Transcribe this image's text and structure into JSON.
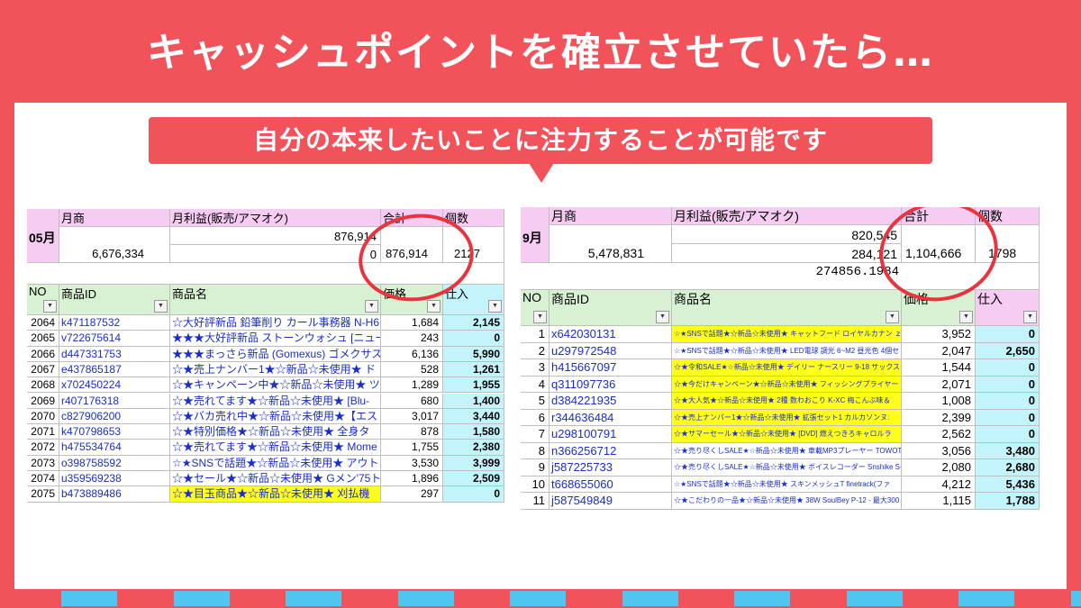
{
  "headline": "キャッシュポイントを確立させていたら…",
  "banner": "自分の本来したいことに注力することが可能です",
  "colors": {
    "bg": "#f2535a",
    "accent_stripe": "#4ec6ef",
    "circle": "#e8343e"
  },
  "left": {
    "month": "05月",
    "sales_label": "月商",
    "profit_label": "月利益(販売/アマオク)",
    "total_label": "合計",
    "count_label": "個数",
    "sales_value": "6,676,334",
    "profit_value_1": "876,914",
    "profit_value_2": "0",
    "total_value": "876,914",
    "count_value": "2127",
    "col_no": "NO",
    "col_id": "商品ID",
    "col_name": "商品名",
    "col_price": "価格",
    "col_buy": "仕入",
    "rows": [
      {
        "no": "2064",
        "id": "k471187532",
        "name": "☆大好評新品 鉛筆削り カール事務器 N-H6",
        "price": "1,684",
        "buy": "2,145"
      },
      {
        "no": "2065",
        "id": "v722675614",
        "name": "★★★大好評新品 ストーンウォシュ [ニュー",
        "price": "243",
        "buy": "0"
      },
      {
        "no": "2066",
        "id": "d447331753",
        "name": "★★★まっさら新品 (Gomexus) ゴメクサス C",
        "price": "6,136",
        "buy": "5,990"
      },
      {
        "no": "2067",
        "id": "e437865187",
        "name": "☆★売上ナンバー1★☆新品☆未使用★ ド",
        "price": "528",
        "buy": "1,261"
      },
      {
        "no": "2068",
        "id": "x702450224",
        "name": "☆★キャンペーン中★☆新品☆未使用★ ツ",
        "price": "1,289",
        "buy": "1,955"
      },
      {
        "no": "2069",
        "id": "r407176318",
        "name": "☆★売れてます★☆新品☆未使用★ [Blu-",
        "price": "680",
        "buy": "1,400"
      },
      {
        "no": "2070",
        "id": "c827906200",
        "name": "☆★バカ売れ中★☆新品☆未使用★【エス",
        "price": "3,017",
        "buy": "3,440"
      },
      {
        "no": "2071",
        "id": "k470798653",
        "name": "☆★特別価格★☆新品☆未使用★ 全身タ",
        "price": "878",
        "buy": "1,580"
      },
      {
        "no": "2072",
        "id": "h475534764",
        "name": "☆★売れてます★☆新品☆未使用★ Mome",
        "price": "1,755",
        "buy": "2,380"
      },
      {
        "no": "2073",
        "id": "o398758592",
        "name": "☆★SNSで話題★☆新品☆未使用★ アウト",
        "price": "3,530",
        "buy": "3,999"
      },
      {
        "no": "2074",
        "id": "u359569238",
        "name": "☆★セール★☆新品☆未使用★ Gメン'75ト",
        "price": "1,896",
        "buy": "2,509"
      },
      {
        "no": "2075",
        "id": "b473889486",
        "name": "☆★目玉商品★☆新品☆未使用★ 刈払機",
        "price": "297",
        "buy": "0",
        "highlight": true
      }
    ]
  },
  "right": {
    "month": "9月",
    "sales_label": "月商",
    "profit_label": "月利益(販売/アマオク)",
    "total_label": "合計",
    "count_label": "個数",
    "sales_value": "5,478,831",
    "profit_value_1": "820,545",
    "profit_value_2": "284,121",
    "total_value": "1,104,666",
    "count_value": "1798",
    "extra_value": "274856.1984",
    "col_no": "NO",
    "col_id": "商品ID",
    "col_name": "商品名",
    "col_price": "価格",
    "col_buy": "仕入",
    "rows": [
      {
        "no": "1",
        "id": "x642030131",
        "name": "☆★SNSで話題★☆新品☆未使用★ キャットフード ロイヤルカナン ｚ-",
        "price": "3,952",
        "buy": "0",
        "highlight": true
      },
      {
        "no": "2",
        "id": "u297972548",
        "name": "☆★SNSで話題★☆新品☆未使用★ LED電球 調光 6~M2 昼光色 4個セ",
        "price": "2,047",
        "buy": "2,650"
      },
      {
        "no": "3",
        "id": "h415667097",
        "name": "☆★令和SALE★☆新品☆未使用★ デイリー ナースリー 9-18 サックス 9",
        "price": "1,544",
        "buy": "0",
        "highlight": true
      },
      {
        "no": "4",
        "id": "q311097736",
        "name": "☆★今だけキャンペーン★☆新品☆未使用★ フィッシングプライヤー",
        "price": "2,071",
        "buy": "0",
        "highlight": true
      },
      {
        "no": "5",
        "id": "d384221935",
        "name": "☆★大人気★☆新品☆未使用★ 2種 数わおこり K-XC 梅こんぶ味＆",
        "price": "1,008",
        "buy": "0",
        "highlight": true
      },
      {
        "no": "6",
        "id": "r344636484",
        "name": "☆★売上ナンバー1★☆新品☆未使用★ 拡張セット1 カルカソンヌ:",
        "price": "2,399",
        "buy": "0",
        "highlight": true
      },
      {
        "no": "7",
        "id": "u298100791",
        "name": "☆★サマーセール★☆新品☆未使用★ [DVD] 燃えつきろキャロルラ",
        "price": "2,562",
        "buy": "0",
        "highlight": true
      },
      {
        "no": "8",
        "id": "n366256712",
        "name": "☆★売り尽くしSALE★☆新品☆未使用★ 車載MP3プレーヤー TOWOTO V",
        "price": "3,056",
        "buy": "3,480"
      },
      {
        "no": "9",
        "id": "j587225733",
        "name": "☆★売り尽くしSALE★☆新品☆未使用★ ボイスレコーダー Snshike S-K",
        "price": "2,080",
        "buy": "2,680"
      },
      {
        "no": "10",
        "id": "t668655060",
        "name": "☆★SNSで話題★☆新品☆未使用★ スキンメッシュT finetrack(ファ",
        "price": "4,212",
        "buy": "5,436"
      },
      {
        "no": "11",
        "id": "j587549849",
        "name": "☆★こだわりの一品★☆新品☆未使用★ 38W SoulBey P-12 - 最大300",
        "price": "1,115",
        "buy": "1,788"
      }
    ]
  }
}
